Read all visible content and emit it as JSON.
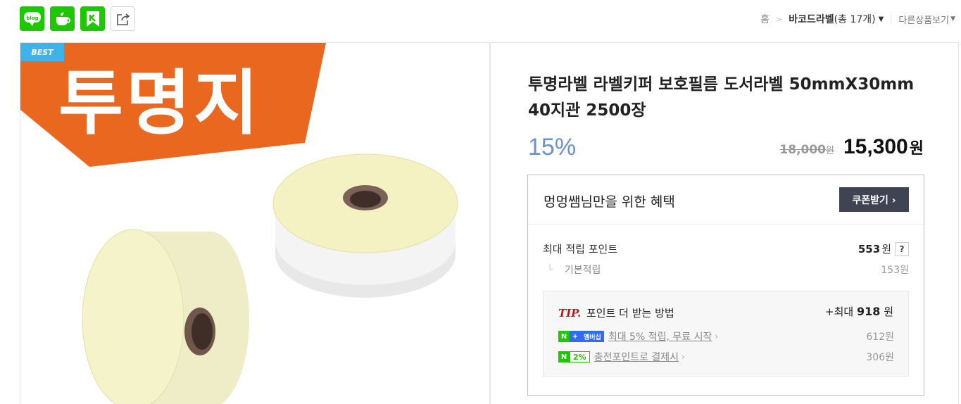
{
  "share": {
    "blog_label": "blog",
    "icons": [
      "blog-icon",
      "cafe-icon",
      "keep-icon",
      "share-icon"
    ]
  },
  "breadcrumb": {
    "home": "홈",
    "category": "바코드라벨",
    "count": "(총 17개)",
    "other": "다른상품보기"
  },
  "image": {
    "badge": "BEST",
    "banner_text": "투명지",
    "colors": {
      "banner": "#e9671f",
      "roll": "#f4f1c3",
      "badge": "#3fb2e8"
    }
  },
  "product": {
    "title": "투명라벨 라벨키퍼 보호필름 도서라벨 50mmX30mm 40지관 2500장",
    "discount": "15%",
    "original_price": "18,000",
    "original_won": "원",
    "sale_price": "15,300",
    "sale_won": "원"
  },
  "benefit": {
    "title": "멍멍쌤님만을 위한 혜택",
    "coupon_button": "쿠폰받기 ›",
    "max_point_label": "최대 적립 포인트",
    "max_point_value": "553",
    "won": "원",
    "help": "?",
    "base_label": "기본적립",
    "base_value": "153원"
  },
  "tip": {
    "label": "TIP.",
    "title": "포인트 더 받는 방법",
    "max_prefix": "+최대",
    "max_value": "918",
    "max_won": "원",
    "items": [
      {
        "badge_n": "N",
        "badge_plus": "+",
        "badge_text": "멤버십",
        "text": "최대 5% 적립, 무료 시작",
        "value": "612원"
      },
      {
        "badge_n": "N",
        "badge_text": "2%",
        "text": "충전포인트로 결제시",
        "value": "306원"
      }
    ]
  }
}
